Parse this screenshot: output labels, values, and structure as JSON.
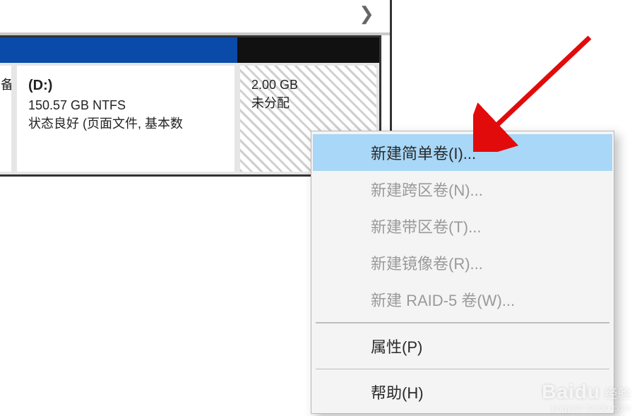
{
  "scroll_glyph": "❯",
  "volumes": {
    "left_sliver_text": "备",
    "d": {
      "drive": "(D:)",
      "info": "150.57 GB NTFS",
      "status": "状态良好 (页面文件, 基本数"
    },
    "unallocated": {
      "size": "2.00 GB",
      "label": "未分配"
    }
  },
  "context_menu": {
    "items": [
      {
        "label": "新建简单卷(I)...",
        "enabled": true,
        "highlight": true
      },
      {
        "label": "新建跨区卷(N)...",
        "enabled": false,
        "highlight": false
      },
      {
        "label": "新建带区卷(T)...",
        "enabled": false,
        "highlight": false
      },
      {
        "label": "新建镜像卷(R)...",
        "enabled": false,
        "highlight": false
      },
      {
        "label": "新建 RAID-5 卷(W)...",
        "enabled": false,
        "highlight": false
      }
    ],
    "properties": "属性(P)",
    "help": "帮助(H)"
  },
  "watermark": {
    "brand": "Baidu",
    "sub": "经验",
    "url": "jingyan.baidu.com"
  },
  "colors": {
    "primary_header": "#0a4aa8",
    "menu_highlight": "#a8d7f7",
    "arrow": "#e20b0b"
  }
}
